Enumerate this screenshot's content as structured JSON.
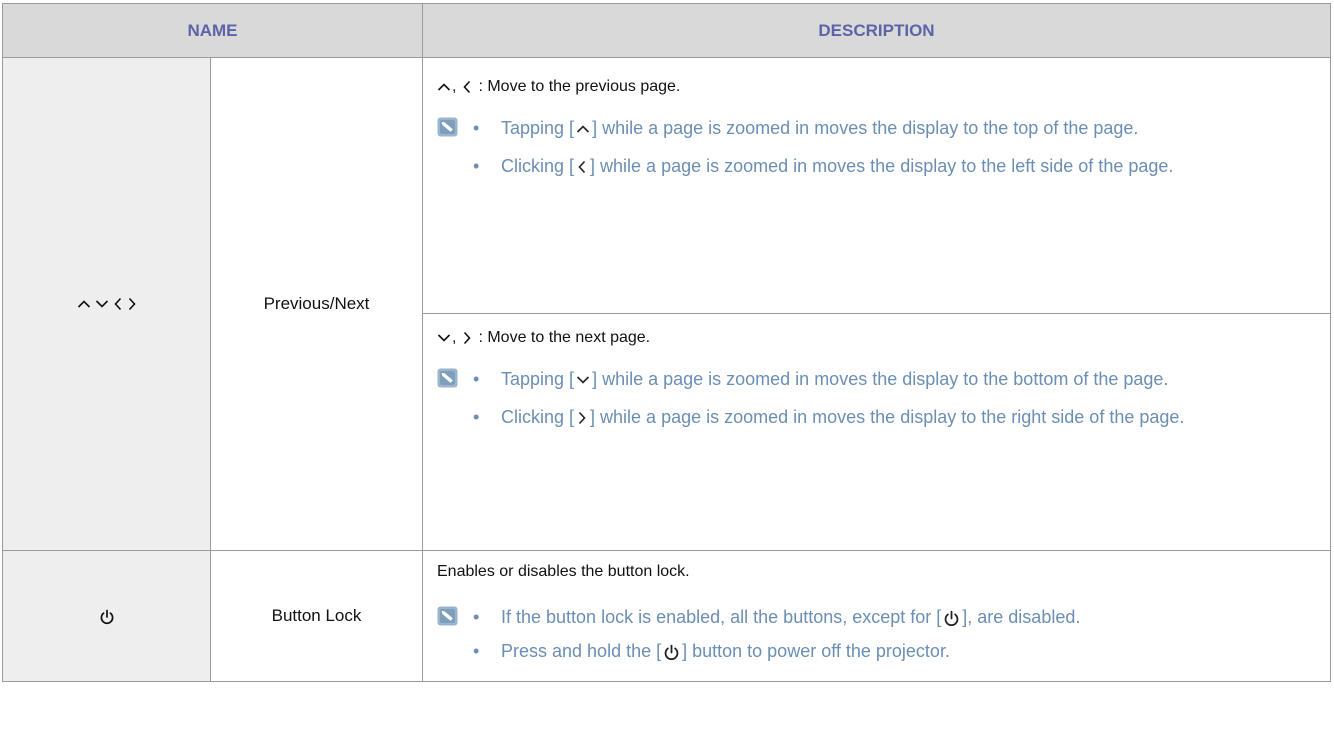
{
  "header": {
    "name": "NAME",
    "description": "DESCRIPTION"
  },
  "rows": [
    {
      "name_icons": [
        "chevron-up-icon",
        "chevron-down-icon",
        "chevron-left-icon",
        "chevron-right-icon"
      ],
      "function": "Previous/Next",
      "sections": [
        {
          "main": ": Move to the previous page.",
          "bullets": [
            {
              "before": "Tapping [",
              "after": "] while a page is zoomed in moves the display to the top of the page."
            },
            {
              "before": "Clicking [",
              "after": "] while a page is zoomed in moves the display to the left side of the page."
            }
          ]
        },
        {
          "main": ": Move to the next page.",
          "bullets": [
            {
              "before": "Tapping [",
              "after": "] while a page is zoomed in moves the display to the bottom of the page."
            },
            {
              "before": "Clicking [",
              "after": "] while a page is zoomed in moves the display to the right side of the page."
            }
          ]
        }
      ]
    },
    {
      "name_icons": [
        "power-icon"
      ],
      "function": "Button Lock",
      "sections": [
        {
          "main": "Enables or disables the button lock.",
          "bullets": [
            {
              "before": "If the button lock is enabled, all the buttons, except for [",
              "after": "], are disabled."
            },
            {
              "before": "Press and hold the [",
              "after": "] button to power off the projector."
            }
          ]
        }
      ]
    }
  ],
  "colors": {
    "header_bg": "#d9d9d9",
    "header_text": "#5d63a8",
    "name_bg": "#eeeeee",
    "note_text": "#6b8eb4",
    "border": "#9a9a9a"
  }
}
